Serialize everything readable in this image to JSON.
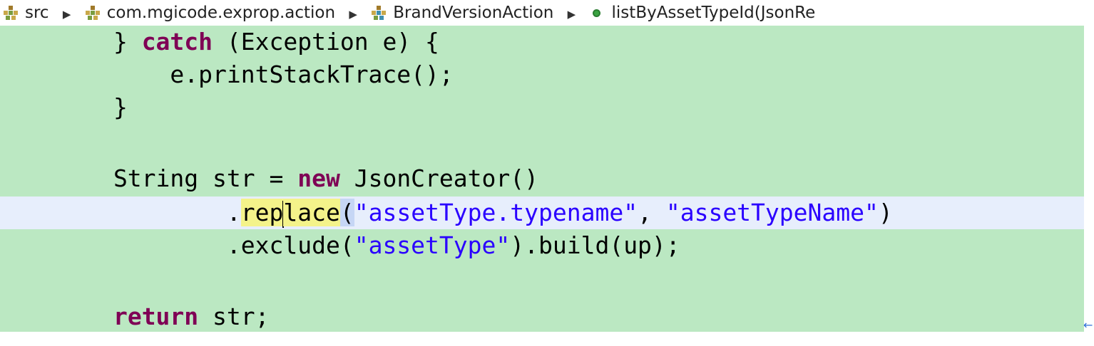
{
  "breadcrumb": {
    "items": [
      {
        "label": "src",
        "icon": "package-folder-icon"
      },
      {
        "label": "com.mgicode.exprop.action",
        "icon": "package-icon"
      },
      {
        "label": "BrandVersionAction",
        "icon": "class-icon"
      },
      {
        "label": "listByAssetTypeId(JsonRe",
        "icon": "public-method-icon"
      }
    ],
    "separator": "▶"
  },
  "editor": {
    "colors": {
      "background": "#bbe8c2",
      "current_line": "#e7eefc",
      "keyword": "#7f0055",
      "string": "#2a00ff",
      "word_highlight": "#f4f38a"
    },
    "lines": {
      "l1": {
        "p1": "        } ",
        "kw": "catch",
        "p2": " (Exception e) {"
      },
      "l2": {
        "p1": "            e.printStackTrace();"
      },
      "l3": {
        "p1": "        }"
      },
      "l4": {
        "p1": ""
      },
      "l5": {
        "p1": "        String str = ",
        "kw": "new",
        "p2": " JsonCreator()"
      },
      "l6": {
        "p1": "                .",
        "hl_a": "rep",
        "hl_b": "lace",
        "paren": "(",
        "s1": "\"assetType.typename\"",
        "p2": ", ",
        "s2": "\"assetTypeName\"",
        "p3": ")"
      },
      "l7": {
        "p1": "                .exclude(",
        "s1": "\"assetType\"",
        "p2": ").build(up);"
      },
      "l8": {
        "p1": ""
      },
      "l9": {
        "p1": "        ",
        "kw": "return",
        "p2": " str;"
      }
    }
  },
  "scroll_marker": "←"
}
